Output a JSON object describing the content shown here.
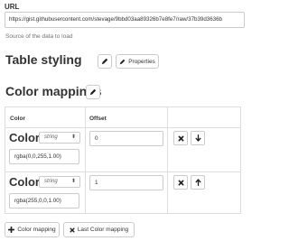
{
  "url_field": {
    "label": "URL",
    "value": "https://gist.githubusercontent.com/stevage/9bbd03aa89326b7e8fe7/raw/37b39d3636b",
    "help": "Source of the data to load"
  },
  "table_styling": {
    "title": "Table styling",
    "properties_button": "Properties"
  },
  "color_mappings": {
    "title": "Color mappings",
    "columns": [
      "Color",
      "Offset"
    ],
    "rows": [
      {
        "field_label": "Color",
        "type": "string",
        "color_value": "rgba(0,0,255,1.00)",
        "offset": "0"
      },
      {
        "field_label": "Color",
        "type": "string",
        "color_value": "rgba(255,0,0,1.00)",
        "offset": "1"
      }
    ],
    "add_button": "Color mapping",
    "last_button": "Last Color mapping"
  }
}
